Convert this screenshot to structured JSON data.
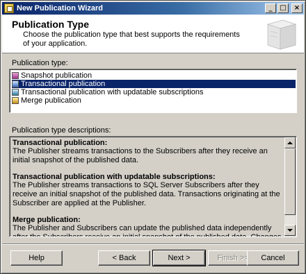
{
  "window": {
    "title": "New Publication Wizard",
    "controls": {
      "minimize": "_",
      "maximize": "□",
      "close": "×"
    }
  },
  "header": {
    "title": "Publication Type",
    "subtitle": "Choose the publication type that best supports the requirements of your application."
  },
  "publication_type": {
    "label": "Publication type:",
    "items": [
      {
        "label": "Snapshot publication",
        "icon": "snapshot-publication-icon"
      },
      {
        "label": "Transactional publication",
        "icon": "transactional-publication-icon",
        "selected": true
      },
      {
        "label": "Transactional publication with updatable subscriptions",
        "icon": "transactional-updatable-publication-icon"
      },
      {
        "label": "Merge publication",
        "icon": "merge-publication-icon"
      }
    ]
  },
  "descriptions": {
    "label": "Publication type descriptions:",
    "sections": [
      {
        "heading": "Transactional publication:",
        "text": "The Publisher streams transactions to the Subscribers after they receive an initial snapshot of the published data."
      },
      {
        "heading": "Transactional publication with updatable subscriptions:",
        "text": "The Publisher streams transactions to SQL Server Subscribers after they receive an initial snapshot of the published data. Transactions originating at the Subscriber are applied at the Publisher."
      },
      {
        "heading": "Merge publication:",
        "text": "The Publisher and Subscribers can update the published data independently after the Subscribers receive an initial snapshot of the published data. Changes are merged"
      }
    ]
  },
  "buttons": {
    "help": "Help",
    "back": "< Back",
    "next": "Next >",
    "finish": "Finish >>|",
    "cancel": "Cancel"
  }
}
